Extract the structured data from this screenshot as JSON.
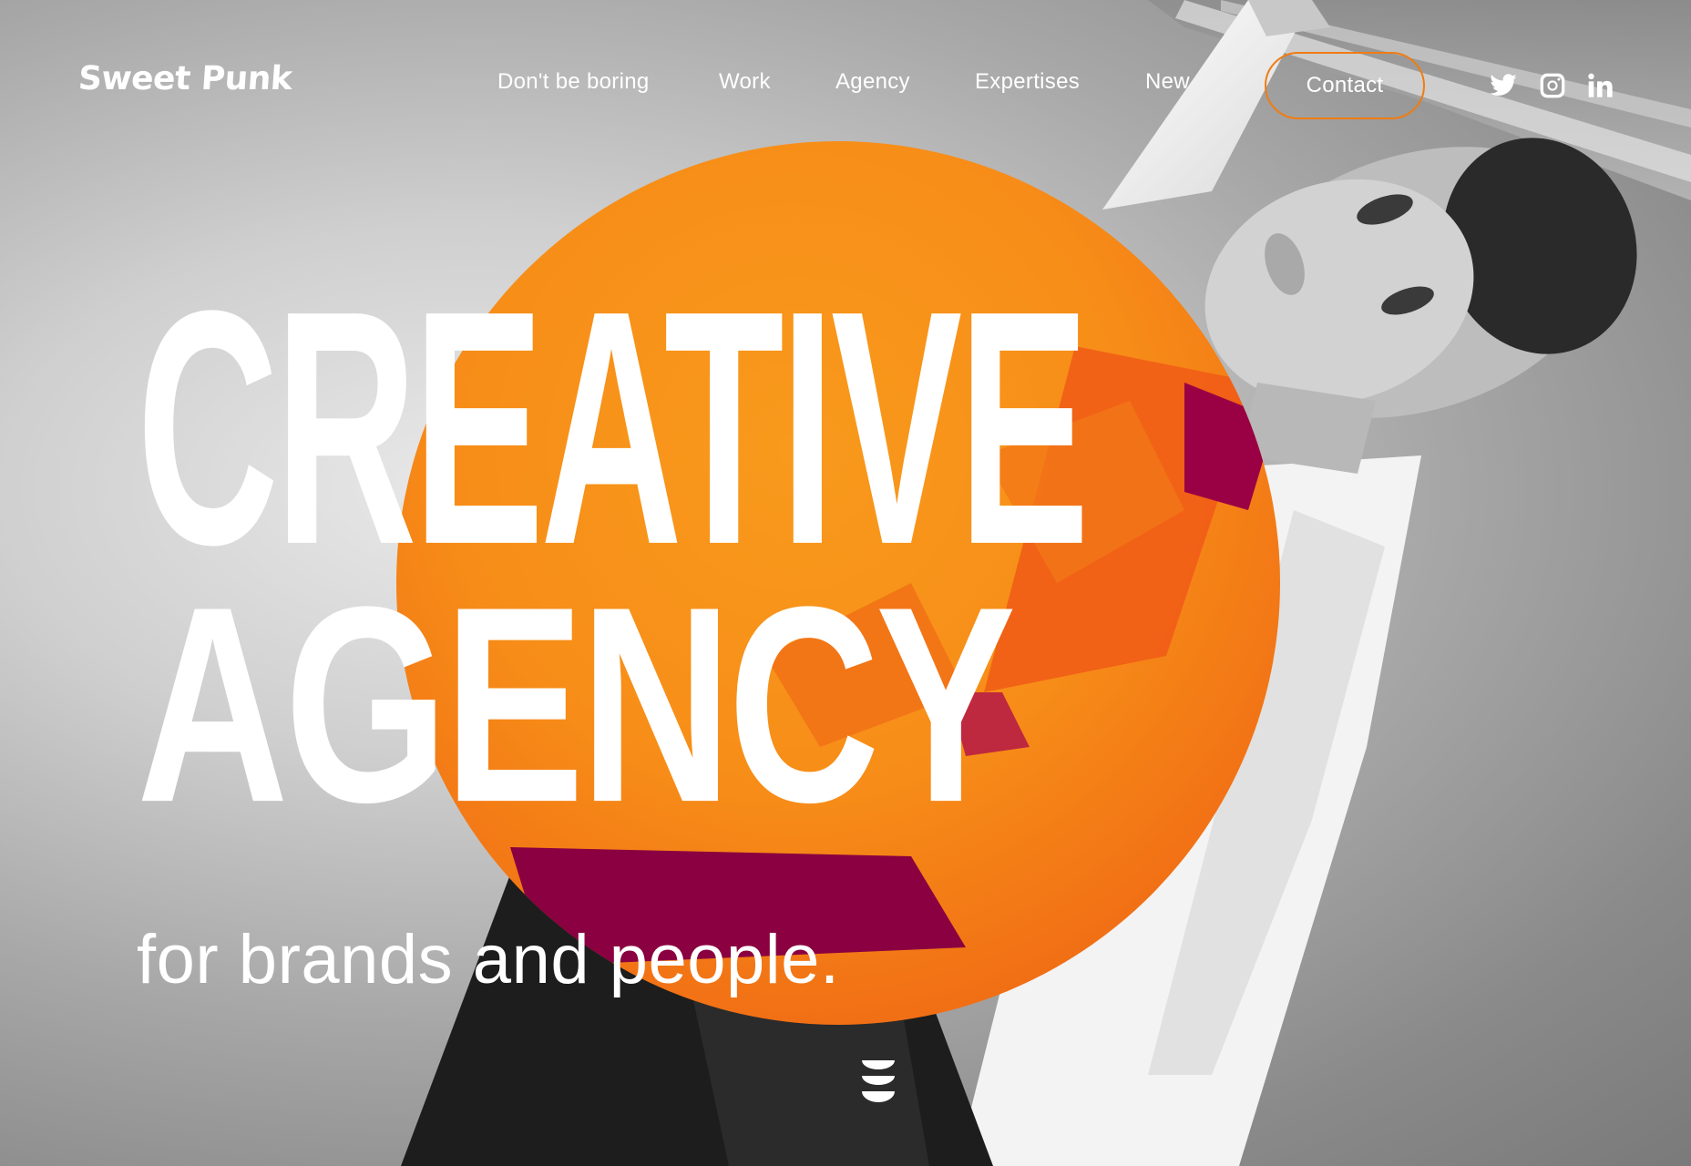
{
  "brand": {
    "logo_text": "Sweet Punk"
  },
  "nav": {
    "items": [
      {
        "label": "Don't be boring"
      },
      {
        "label": "Work"
      },
      {
        "label": "Agency"
      },
      {
        "label": "Expertises"
      },
      {
        "label": "New"
      }
    ],
    "contact_label": "Contact"
  },
  "social": {
    "icons": [
      "twitter-icon",
      "instagram-icon",
      "linkedin-icon"
    ]
  },
  "hero": {
    "headline_line_1": "CREATIVE",
    "headline_line_2": "AGENCY",
    "tagline": "for brands and people.",
    "scroll_icon": "scroll-down-icon"
  },
  "colors": {
    "accent_orange": "#f7921a",
    "accent_red": "#f0501a",
    "accent_magenta": "#8a0040",
    "contact_border": "#f07c12",
    "text": "#ffffff"
  }
}
